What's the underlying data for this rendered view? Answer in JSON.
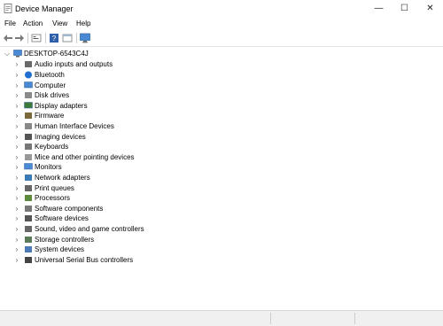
{
  "window": {
    "title": "Device Manager",
    "minimize": "—",
    "maximize": "☐",
    "close": "✕"
  },
  "menu": [
    "File",
    "Action",
    "View",
    "Help"
  ],
  "toolbar": [
    "back-arrow-icon",
    "forward-arrow-icon",
    "properties-icon",
    "help-icon",
    "view-icon",
    "monitor-icon"
  ],
  "tree": {
    "root": "DESKTOP-6543C4J",
    "items": [
      {
        "label": "Audio inputs and outputs",
        "icon": "speaker-icon"
      },
      {
        "label": "Bluetooth",
        "icon": "bluetooth-icon"
      },
      {
        "label": "Computer",
        "icon": "computer-icon"
      },
      {
        "label": "Disk drives",
        "icon": "disk-drive-icon"
      },
      {
        "label": "Display adapters",
        "icon": "display-adapter-icon"
      },
      {
        "label": "Firmware",
        "icon": "firmware-icon"
      },
      {
        "label": "Human Interface Devices",
        "icon": "hid-icon"
      },
      {
        "label": "Imaging devices",
        "icon": "camera-icon"
      },
      {
        "label": "Keyboards",
        "icon": "keyboard-icon"
      },
      {
        "label": "Mice and other pointing devices",
        "icon": "mouse-icon"
      },
      {
        "label": "Monitors",
        "icon": "monitor-icon"
      },
      {
        "label": "Network adapters",
        "icon": "network-icon"
      },
      {
        "label": "Print queues",
        "icon": "printer-icon"
      },
      {
        "label": "Processors",
        "icon": "processor-icon"
      },
      {
        "label": "Software components",
        "icon": "software-component-icon"
      },
      {
        "label": "Software devices",
        "icon": "software-device-icon"
      },
      {
        "label": "Sound, video and game controllers",
        "icon": "sound-icon"
      },
      {
        "label": "Storage controllers",
        "icon": "storage-icon"
      },
      {
        "label": "System devices",
        "icon": "system-device-icon"
      },
      {
        "label": "Universal Serial Bus controllers",
        "icon": "usb-icon"
      }
    ]
  }
}
